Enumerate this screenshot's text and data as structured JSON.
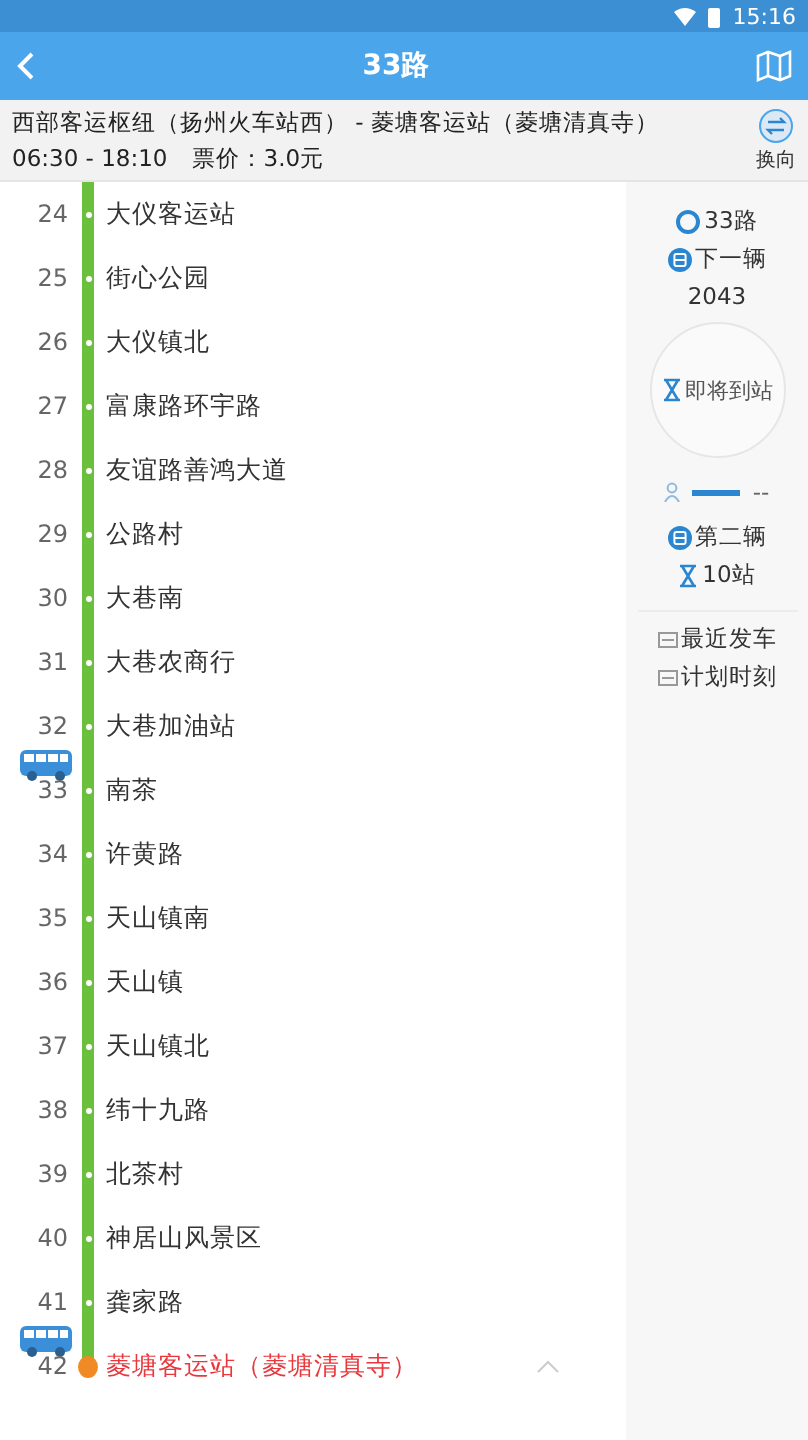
{
  "status_bar": {
    "time": "15:16"
  },
  "header": {
    "title": "33路"
  },
  "route": {
    "name": "西部客运枢纽（扬州火车站西） - 菱塘客运站（菱塘清真寺）",
    "hours": "06:30 - 18:10",
    "fare": "票价：3.0元",
    "switch_label": "换向"
  },
  "stops": [
    {
      "num": "24",
      "name": "大仪客运站",
      "kind": "stop",
      "bus_after": false
    },
    {
      "num": "25",
      "name": "街心公园",
      "kind": "stop",
      "bus_after": false
    },
    {
      "num": "26",
      "name": "大仪镇北",
      "kind": "stop",
      "bus_after": false
    },
    {
      "num": "27",
      "name": "富康路环宇路",
      "kind": "stop",
      "bus_after": false
    },
    {
      "num": "28",
      "name": "友谊路善鸿大道",
      "kind": "stop",
      "bus_after": false
    },
    {
      "num": "29",
      "name": "公路村",
      "kind": "stop",
      "bus_after": false
    },
    {
      "num": "30",
      "name": "大巷南",
      "kind": "stop",
      "bus_after": false
    },
    {
      "num": "31",
      "name": "大巷农商行",
      "kind": "stop",
      "bus_after": false
    },
    {
      "num": "32",
      "name": "大巷加油站",
      "kind": "stop",
      "bus_after": true
    },
    {
      "num": "33",
      "name": "南茶",
      "kind": "stop",
      "bus_after": false
    },
    {
      "num": "34",
      "name": "许黄路",
      "kind": "stop",
      "bus_after": false
    },
    {
      "num": "35",
      "name": "天山镇南",
      "kind": "stop",
      "bus_after": false
    },
    {
      "num": "36",
      "name": "天山镇",
      "kind": "stop",
      "bus_after": false
    },
    {
      "num": "37",
      "name": "天山镇北",
      "kind": "stop",
      "bus_after": false
    },
    {
      "num": "38",
      "name": "纬十九路",
      "kind": "stop",
      "bus_after": false
    },
    {
      "num": "39",
      "name": "北茶村",
      "kind": "stop",
      "bus_after": false
    },
    {
      "num": "40",
      "name": "神居山风景区",
      "kind": "stop",
      "bus_after": false
    },
    {
      "num": "41",
      "name": "龚家路",
      "kind": "stop",
      "bus_after": true
    },
    {
      "num": "42",
      "name": "菱塘客运站（菱塘清真寺）",
      "kind": "terminal",
      "bus_after": false
    }
  ],
  "panel": {
    "line": "33路",
    "next_label": "下一辆",
    "next_bus": "2043",
    "arriving": "即将到站",
    "crowd": "--",
    "second_label": "第二辆",
    "second_stops": "10站",
    "links": [
      "最近发车",
      "计划时刻"
    ]
  }
}
